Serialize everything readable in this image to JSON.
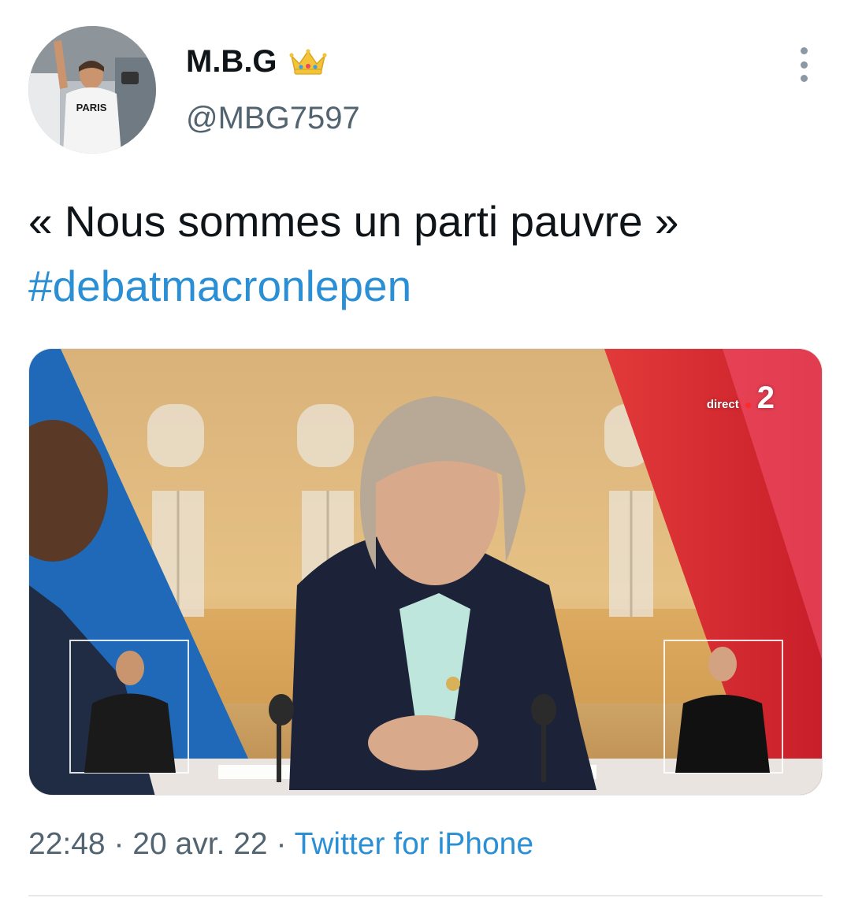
{
  "user": {
    "display_name": "M.B.G",
    "handle": "@MBG7597",
    "badge_icon": "crown-icon"
  },
  "tweet": {
    "text_line": "« Nous sommes un parti pauvre »",
    "hashtag": "#debatmacronlepen",
    "media": {
      "channel_label": "direct",
      "channel_number": "2"
    },
    "time": "22:48",
    "separator": "·",
    "date": "20 avr. 22",
    "source": "Twitter for iPhone"
  },
  "colors": {
    "link": "#2a8fd4",
    "secondary_text": "#536471",
    "primary_text": "#0f1419"
  }
}
